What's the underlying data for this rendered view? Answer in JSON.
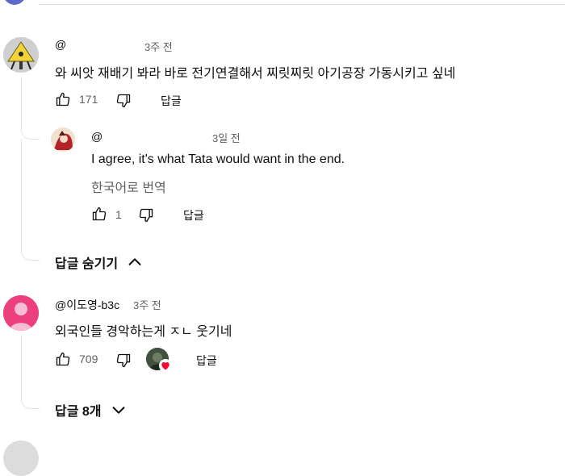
{
  "comments": [
    {
      "handle": "@",
      "time": "3주 전",
      "text": "와 씨앗 재배기 봐라 바로 전기연결해서 찌릿찌릿 아기공장 가동시키고 싶네",
      "likes": "171",
      "reply_label": "답글",
      "toggle_label": "답글 숨기기",
      "replies": [
        {
          "handle": "@",
          "time": "3일 전",
          "text": "I agree, it's what Tata would want in the end.",
          "translate_label": "한국어로 번역",
          "likes": "1",
          "reply_label": "답글"
        }
      ]
    },
    {
      "handle": "@이도영-b3c",
      "time": "3주 전",
      "text": "외국인들 경악하는게 ㅈㄴ 웃기네",
      "likes": "709",
      "reply_label": "답글",
      "toggle_label": "답글 8개"
    }
  ],
  "colors": {
    "avatar_pink": "#ec3f7c",
    "heart_red": "#ff0033",
    "secondary_text": "#606060"
  },
  "icons": [
    "thumbs-up-icon",
    "thumbs-down-icon",
    "chevron-up-icon",
    "chevron-down-icon",
    "heart-icon"
  ]
}
